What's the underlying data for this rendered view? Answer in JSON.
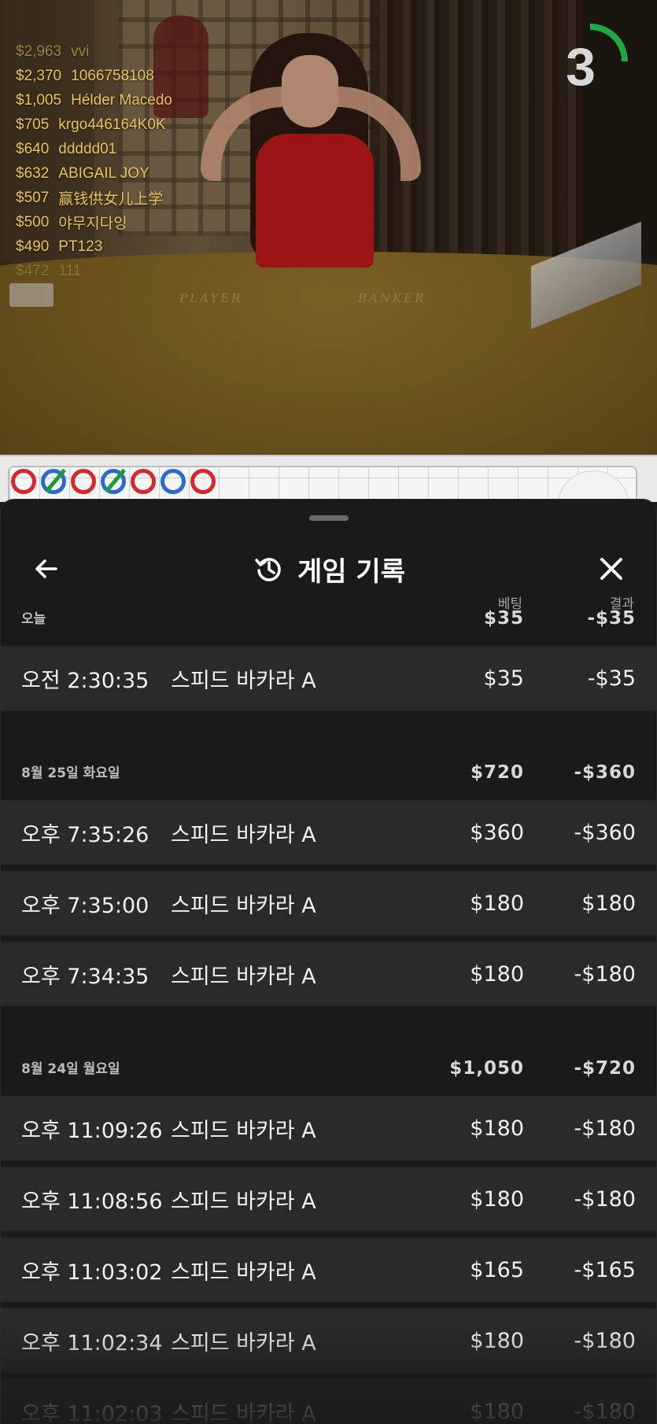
{
  "leaderboard": [
    {
      "amount": "$2,963",
      "name": "vvi"
    },
    {
      "amount": "$2,370",
      "name": "1066758108"
    },
    {
      "amount": "$1,005",
      "name": "Hélder Macedo"
    },
    {
      "amount": "$705",
      "name": "krgo446164K0K"
    },
    {
      "amount": "$640",
      "name": "ddddd01"
    },
    {
      "amount": "$632",
      "name": "ABIGAIL JOY"
    },
    {
      "amount": "$507",
      "name": "赢钱供女儿上学"
    },
    {
      "amount": "$500",
      "name": "야무지다잉"
    },
    {
      "amount": "$490",
      "name": "PT123"
    },
    {
      "amount": "$472",
      "name": "111"
    }
  ],
  "table_labels": {
    "player": "PLAYER",
    "banker": "BANKER"
  },
  "timer": {
    "value": "3",
    "progress": 0.25,
    "color": "#1fa845"
  },
  "road": {
    "beads": [
      "red",
      "blue-tie",
      "red",
      "blue-tie",
      "red",
      "blue",
      "red"
    ]
  },
  "history": {
    "title": "게임 기록",
    "columns": {
      "bet": "베팅",
      "result": "결과"
    },
    "days": [
      {
        "label": "오늘",
        "bet_total": "$35",
        "result_total": "-$35",
        "rows": [
          {
            "time": "오전 2:30:35",
            "game": "스피드 바카라 A",
            "bet": "$35",
            "result": "-$35"
          }
        ]
      },
      {
        "label": "8월 25일 화요일",
        "bet_total": "$720",
        "result_total": "-$360",
        "rows": [
          {
            "time": "오후 7:35:26",
            "game": "스피드 바카라 A",
            "bet": "$360",
            "result": "-$360"
          },
          {
            "time": "오후 7:35:00",
            "game": "스피드 바카라 A",
            "bet": "$180",
            "result": "$180"
          },
          {
            "time": "오후 7:34:35",
            "game": "스피드 바카라 A",
            "bet": "$180",
            "result": "-$180"
          }
        ]
      },
      {
        "label": "8월 24일 월요일",
        "bet_total": "$1,050",
        "result_total": "-$720",
        "rows": [
          {
            "time": "오후 11:09:26",
            "game": "스피드 바카라 A",
            "bet": "$180",
            "result": "-$180"
          },
          {
            "time": "오후 11:08:56",
            "game": "스피드 바카라 A",
            "bet": "$180",
            "result": "-$180"
          },
          {
            "time": "오후 11:03:02",
            "game": "스피드 바카라 A",
            "bet": "$165",
            "result": "-$165"
          },
          {
            "time": "오후 11:02:34",
            "game": "스피드 바카라 A",
            "bet": "$180",
            "result": "-$180"
          },
          {
            "time": "오후 11:02:03",
            "game": "스피드 바카라 A",
            "bet": "$180",
            "result": "-$180"
          }
        ]
      }
    ]
  },
  "icons": {
    "back": "arrow-left-icon",
    "history": "history-clock-icon",
    "close": "close-icon"
  }
}
